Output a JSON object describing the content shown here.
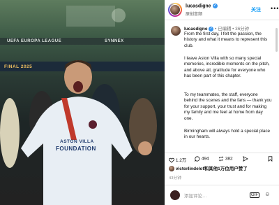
{
  "photo": {
    "banner_left": "UEFA EUROPA LEAGUE",
    "banner_right": "SYNNEX",
    "final_text": "FINAL 2025",
    "shirt_line1": "ASTON VILLA",
    "shirt_line2": "FOUNDATION"
  },
  "header": {
    "username": "lucasdigne",
    "subtitle": "原创音频",
    "follow_label": "关注",
    "more_label": "•••"
  },
  "caption": {
    "username": "lucasdigne",
    "edited": "已编辑",
    "time_ago": "36分钟",
    "paragraphs": [
      "From the first day, I felt the passion, the history and what it means to represent this club.",
      "I leave Aston Villa with so many special memories, incredible moments on the pitch, and above all, gratitude for everyone who has been part of this chapter.",
      "To my teammates, the staff, everyone behind the scenes and the fans — thank you for your support, your trust and for making my family and me feel at home from day one.",
      "Birmingham will always hold a special place in our hearts."
    ]
  },
  "actions": {
    "likes_count": "1.2万",
    "comments_count": "494",
    "shares_count": "382"
  },
  "likes": {
    "liked_by": "victorlindelof",
    "suffix": "和其他1万位用户赞了"
  },
  "post_time": "43分钟",
  "comment_box": {
    "placeholder": "添加评论…"
  },
  "icons": [
    "heart-icon",
    "comment-icon",
    "repost-icon",
    "share-icon",
    "bookmark-icon",
    "emoji-icon",
    "gif-icon",
    "verified-icon",
    "more-icon"
  ],
  "colors": {
    "accent": "#0095f6",
    "verified": "#3897f0"
  }
}
